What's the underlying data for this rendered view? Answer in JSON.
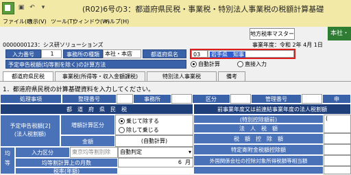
{
  "window": {
    "title": "(R02)6号の3：都道府県民税・事業税・特別法人事業税の税額計算基礎"
  },
  "menu": [
    "ファイル(F)",
    "表示(V)",
    "ツール(T)",
    "ウィンドウ(W)",
    "ヘルプ(H)"
  ],
  "toolbar": {
    "master_button": "地方税率マスター",
    "green_label": "本社・"
  },
  "info": {
    "company": "0000000123：シス研ソリューションズ",
    "fiscal_year": "事業年度：令和 2年 4月 1日"
  },
  "form": {
    "entry_no_label": "入力番号",
    "entry_no_value": "1",
    "office_type_label": "事務所の種類",
    "office_type_value": "本社・本店",
    "pref_name_label": "都道府県名",
    "pref_code": "03",
    "pref_name_value": "岩手県　知事",
    "tax_method_label": "予定申告税額(均等割を除く)の計算方法",
    "radio_auto": "自動計算",
    "radio_direct": "直接入力"
  },
  "tabs": [
    "都道府県民税",
    "事業税(所得等・収入金額課税)",
    "特別法人事業税",
    "備考"
  ],
  "instruction": "1．都道府県民税の計算基礎資料を入力してください。",
  "grid": {
    "headers": [
      "処理事項",
      "整理番号",
      "事務所",
      "区分",
      "管理番号",
      "申"
    ],
    "section_left": "都　道　府　県　民　税",
    "section_right": "前事業年度又は前連結事業年度の法人税割額",
    "yotei_label": "予定申告税額[2]\n(法人税割額)",
    "keisan_kubun": "増額計算区分",
    "opt_include": "乗じて除する",
    "opt_exclude": "除して乗じる",
    "kingaku": "金額",
    "auto_calc": "(自動計算)",
    "right_row1": "(特別控除額前)",
    "right_row2": "法　人　税　額",
    "right_row3": "税　額　控　除　額",
    "right_row4": "特定寄附金税額控除額",
    "right_row5": "外国関係会社の控除対象所得税額等相当額",
    "input_kubun": "入力区分",
    "input_kubun_value": "東京均等割別除",
    "input_kubun_select": "自動判定",
    "months_label": "均等割計算上の月数",
    "months_value": "6",
    "months_unit": "月",
    "side_label": "均\n等",
    "paren_left": "(",
    "bottom_label": "税率(年額)"
  }
}
